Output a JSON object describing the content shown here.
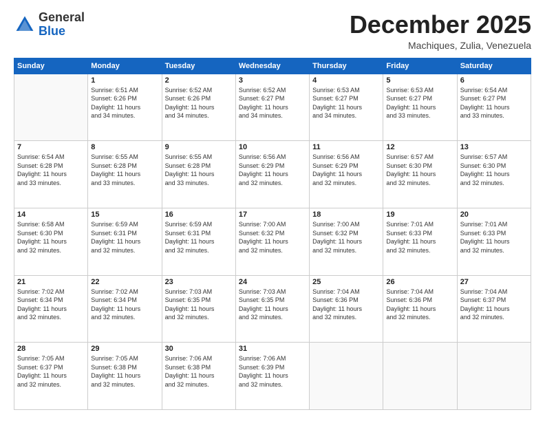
{
  "logo": {
    "general": "General",
    "blue": "Blue"
  },
  "header": {
    "month": "December 2025",
    "location": "Machiques, Zulia, Venezuela"
  },
  "weekdays": [
    "Sunday",
    "Monday",
    "Tuesday",
    "Wednesday",
    "Thursday",
    "Friday",
    "Saturday"
  ],
  "weeks": [
    [
      {
        "day": null
      },
      {
        "day": 1,
        "sunrise": "6:51 AM",
        "sunset": "6:26 PM",
        "daylight": "11 hours and 34 minutes."
      },
      {
        "day": 2,
        "sunrise": "6:52 AM",
        "sunset": "6:26 PM",
        "daylight": "11 hours and 34 minutes."
      },
      {
        "day": 3,
        "sunrise": "6:52 AM",
        "sunset": "6:27 PM",
        "daylight": "11 hours and 34 minutes."
      },
      {
        "day": 4,
        "sunrise": "6:53 AM",
        "sunset": "6:27 PM",
        "daylight": "11 hours and 34 minutes."
      },
      {
        "day": 5,
        "sunrise": "6:53 AM",
        "sunset": "6:27 PM",
        "daylight": "11 hours and 33 minutes."
      },
      {
        "day": 6,
        "sunrise": "6:54 AM",
        "sunset": "6:27 PM",
        "daylight": "11 hours and 33 minutes."
      }
    ],
    [
      {
        "day": 7,
        "sunrise": "6:54 AM",
        "sunset": "6:28 PM",
        "daylight": "11 hours and 33 minutes."
      },
      {
        "day": 8,
        "sunrise": "6:55 AM",
        "sunset": "6:28 PM",
        "daylight": "11 hours and 33 minutes."
      },
      {
        "day": 9,
        "sunrise": "6:55 AM",
        "sunset": "6:28 PM",
        "daylight": "11 hours and 33 minutes."
      },
      {
        "day": 10,
        "sunrise": "6:56 AM",
        "sunset": "6:29 PM",
        "daylight": "11 hours and 32 minutes."
      },
      {
        "day": 11,
        "sunrise": "6:56 AM",
        "sunset": "6:29 PM",
        "daylight": "11 hours and 32 minutes."
      },
      {
        "day": 12,
        "sunrise": "6:57 AM",
        "sunset": "6:30 PM",
        "daylight": "11 hours and 32 minutes."
      },
      {
        "day": 13,
        "sunrise": "6:57 AM",
        "sunset": "6:30 PM",
        "daylight": "11 hours and 32 minutes."
      }
    ],
    [
      {
        "day": 14,
        "sunrise": "6:58 AM",
        "sunset": "6:30 PM",
        "daylight": "11 hours and 32 minutes."
      },
      {
        "day": 15,
        "sunrise": "6:59 AM",
        "sunset": "6:31 PM",
        "daylight": "11 hours and 32 minutes."
      },
      {
        "day": 16,
        "sunrise": "6:59 AM",
        "sunset": "6:31 PM",
        "daylight": "11 hours and 32 minutes."
      },
      {
        "day": 17,
        "sunrise": "7:00 AM",
        "sunset": "6:32 PM",
        "daylight": "11 hours and 32 minutes."
      },
      {
        "day": 18,
        "sunrise": "7:00 AM",
        "sunset": "6:32 PM",
        "daylight": "11 hours and 32 minutes."
      },
      {
        "day": 19,
        "sunrise": "7:01 AM",
        "sunset": "6:33 PM",
        "daylight": "11 hours and 32 minutes."
      },
      {
        "day": 20,
        "sunrise": "7:01 AM",
        "sunset": "6:33 PM",
        "daylight": "11 hours and 32 minutes."
      }
    ],
    [
      {
        "day": 21,
        "sunrise": "7:02 AM",
        "sunset": "6:34 PM",
        "daylight": "11 hours and 32 minutes."
      },
      {
        "day": 22,
        "sunrise": "7:02 AM",
        "sunset": "6:34 PM",
        "daylight": "11 hours and 32 minutes."
      },
      {
        "day": 23,
        "sunrise": "7:03 AM",
        "sunset": "6:35 PM",
        "daylight": "11 hours and 32 minutes."
      },
      {
        "day": 24,
        "sunrise": "7:03 AM",
        "sunset": "6:35 PM",
        "daylight": "11 hours and 32 minutes."
      },
      {
        "day": 25,
        "sunrise": "7:04 AM",
        "sunset": "6:36 PM",
        "daylight": "11 hours and 32 minutes."
      },
      {
        "day": 26,
        "sunrise": "7:04 AM",
        "sunset": "6:36 PM",
        "daylight": "11 hours and 32 minutes."
      },
      {
        "day": 27,
        "sunrise": "7:04 AM",
        "sunset": "6:37 PM",
        "daylight": "11 hours and 32 minutes."
      }
    ],
    [
      {
        "day": 28,
        "sunrise": "7:05 AM",
        "sunset": "6:37 PM",
        "daylight": "11 hours and 32 minutes."
      },
      {
        "day": 29,
        "sunrise": "7:05 AM",
        "sunset": "6:38 PM",
        "daylight": "11 hours and 32 minutes."
      },
      {
        "day": 30,
        "sunrise": "7:06 AM",
        "sunset": "6:38 PM",
        "daylight": "11 hours and 32 minutes."
      },
      {
        "day": 31,
        "sunrise": "7:06 AM",
        "sunset": "6:39 PM",
        "daylight": "11 hours and 32 minutes."
      },
      {
        "day": null
      },
      {
        "day": null
      },
      {
        "day": null
      }
    ]
  ],
  "labels": {
    "sunrise": "Sunrise:",
    "sunset": "Sunset:",
    "daylight": "Daylight:"
  }
}
